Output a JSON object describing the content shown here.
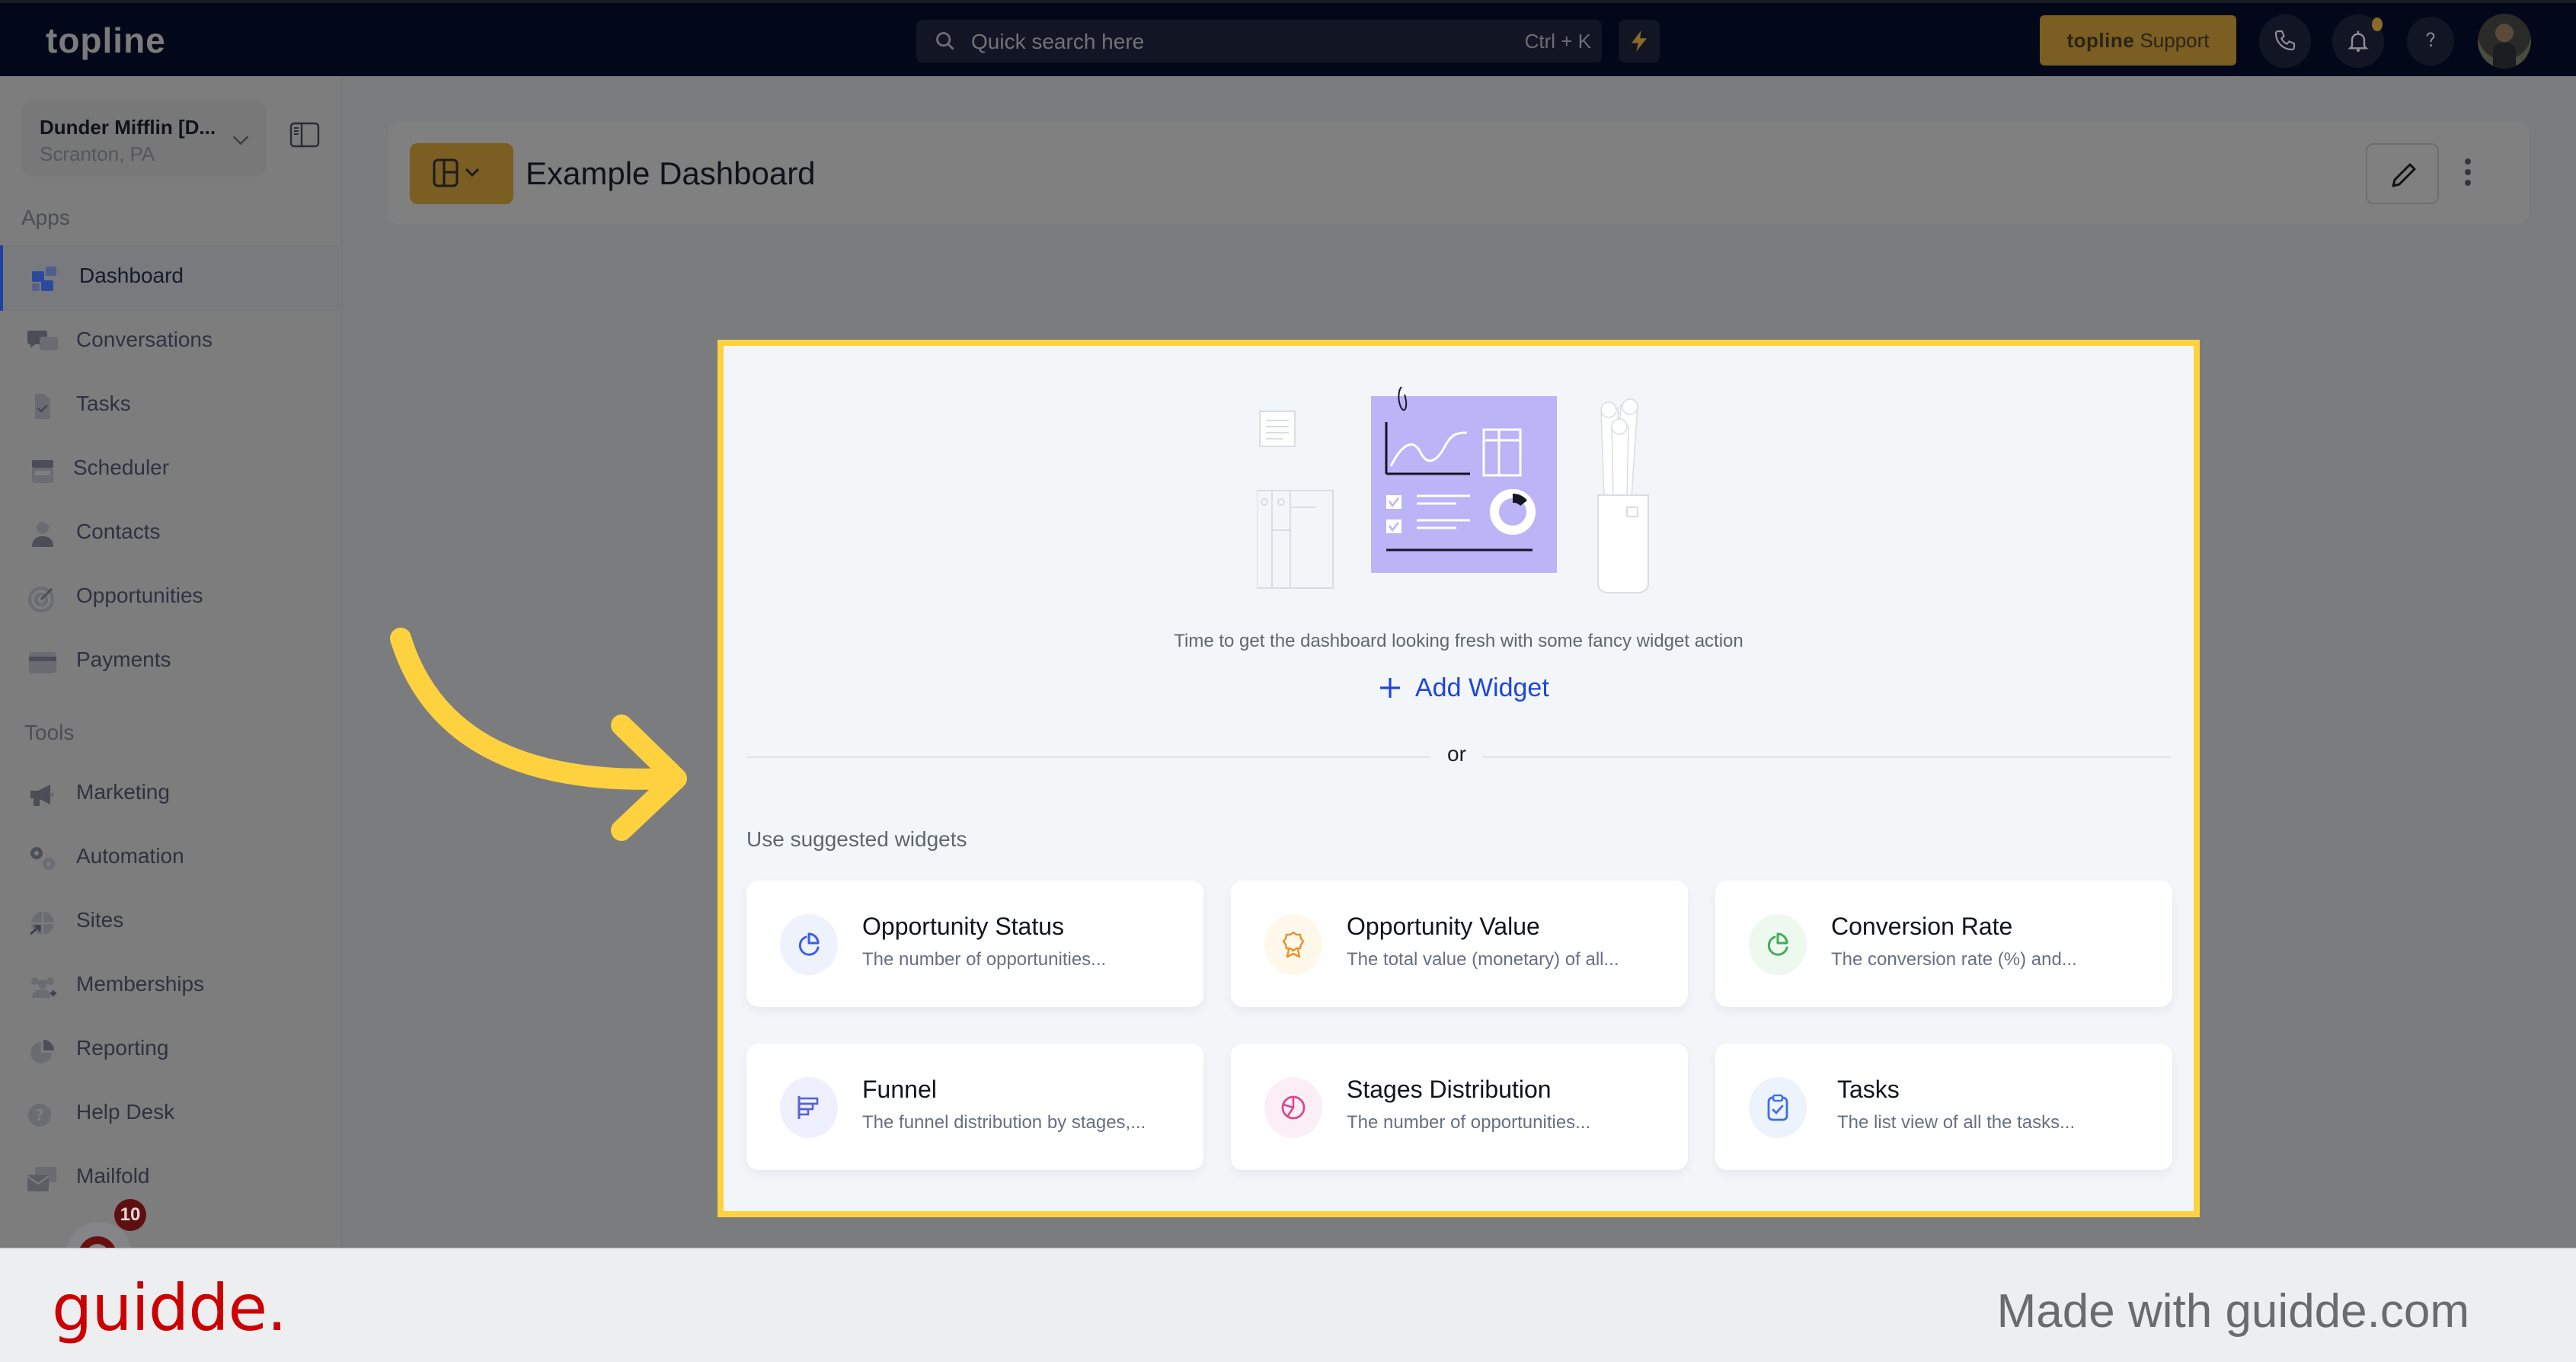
{
  "topbar": {
    "brand": "topline",
    "search_placeholder": "Quick search here",
    "search_shortcut": "Ctrl + K",
    "support_brand": "topline",
    "support_label": "Support",
    "icons": [
      "search-icon",
      "lightning-icon",
      "phone-icon",
      "bell-icon",
      "help-icon",
      "avatar"
    ]
  },
  "sidebar": {
    "location": {
      "name": "Dunder Mifflin [D...",
      "city": "Scranton, PA"
    },
    "apps_label": "Apps",
    "tools_label": "Tools",
    "apps": [
      {
        "label": "Dashboard",
        "icon": "puzzle-icon",
        "active": true
      },
      {
        "label": "Conversations",
        "icon": "chat-icon"
      },
      {
        "label": "Tasks",
        "icon": "task-file-icon"
      },
      {
        "label": "Scheduler",
        "icon": "calendar-icon"
      },
      {
        "label": "Contacts",
        "icon": "user-icon"
      },
      {
        "label": "Opportunities",
        "icon": "target-icon"
      },
      {
        "label": "Payments",
        "icon": "credit-card-icon"
      }
    ],
    "tools": [
      {
        "label": "Marketing",
        "icon": "megaphone-icon"
      },
      {
        "label": "Automation",
        "icon": "gears-icon"
      },
      {
        "label": "Sites",
        "icon": "globe-icon"
      },
      {
        "label": "Memberships",
        "icon": "users-plus-icon"
      },
      {
        "label": "Reporting",
        "icon": "pie-chart-icon"
      },
      {
        "label": "Help Desk",
        "icon": "question-circle-icon"
      },
      {
        "label": "Mailfold",
        "icon": "mail-icon"
      }
    ],
    "badge_count": "10"
  },
  "header": {
    "title": "Example Dashboard"
  },
  "empty_state": {
    "tagline": "Time to get the dashboard looking fresh with some fancy widget action",
    "add_widget_label": "Add Widget",
    "or_label": "or",
    "suggested_label": "Use suggested widgets",
    "widgets": [
      {
        "title": "Opportunity Status",
        "description": "The number of opportunities...",
        "icon": "pie-chart-icon",
        "color": "#3b5ee8",
        "bg": "#edf2fd"
      },
      {
        "title": "Opportunity Value",
        "description": "The total value (monetary) of all...",
        "icon": "award-icon",
        "color": "#e8912d",
        "bg": "#fdf8ea"
      },
      {
        "title": "Conversion Rate",
        "description": "The conversion rate (%) and...",
        "icon": "pie-chart-icon",
        "color": "#3fae5c",
        "bg": "#edf8ef"
      },
      {
        "title": "Funnel",
        "description": "The funnel distribution by stages,...",
        "icon": "funnel-icon",
        "color": "#5860e0",
        "bg": "#eef0fd"
      },
      {
        "title": "Stages Distribution",
        "description": "The number of opportunities...",
        "icon": "stage-pie-icon",
        "color": "#d9488e",
        "bg": "#fbeff5"
      },
      {
        "title": "Tasks",
        "description": "The list view of all the tasks...",
        "icon": "clipboard-check-icon",
        "color": "#3b6ee8",
        "bg": "#edf3fd"
      }
    ]
  },
  "footer": {
    "logo": "guidde.",
    "made_with": "Made with guidde.com"
  },
  "colors": {
    "highlight": "#fed23f",
    "accent_blue": "#1f47d5",
    "gold": "#7a5e22",
    "illustration_purple": "#bbb4f6"
  }
}
